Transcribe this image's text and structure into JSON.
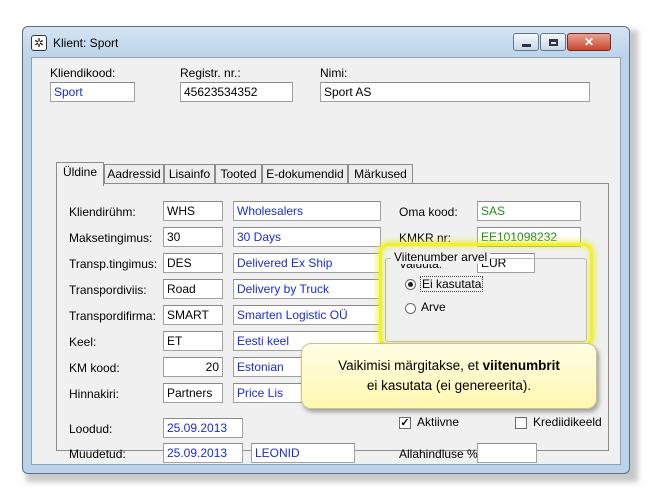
{
  "window": {
    "title": "Klient: Sport"
  },
  "header": {
    "client_code_label": "Kliendikood:",
    "client_code": "Sport",
    "reg_no_label": "Registr. nr.:",
    "reg_no": "45623534352",
    "name_label": "Nimi:",
    "name": "Sport AS"
  },
  "tabs": [
    {
      "label": "Üldine"
    },
    {
      "label": "Aadressid"
    },
    {
      "label": "Lisainfo"
    },
    {
      "label": "Tooted"
    },
    {
      "label": "E-dokumendid"
    },
    {
      "label": "Märkused"
    }
  ],
  "general": {
    "client_group": {
      "label": "Kliendirühm:",
      "code": "WHS",
      "desc": "Wholesalers"
    },
    "payment_terms": {
      "label": "Maksetingimus:",
      "code": "30",
      "desc": "30 Days"
    },
    "transport_terms": {
      "label": "Transp.tingimus:",
      "code": "DES",
      "desc": "Delivered Ex Ship"
    },
    "transport_mode": {
      "label": "Transpordiviis:",
      "code": "Road",
      "desc": "Delivery by Truck"
    },
    "transport_company": {
      "label": "Transpordifirma:",
      "code": "SMART",
      "desc": "Smarten Logistic OÜ"
    },
    "language": {
      "label": "Keel:",
      "code": "ET",
      "desc": "Eesti keel"
    },
    "vat_code": {
      "label": "KM kood:",
      "code": "20",
      "desc": "Estonian"
    },
    "price_list": {
      "label": "Hinnakiri:",
      "code": "Partners",
      "desc": "Price Lis"
    },
    "created": {
      "label": "Loodud:",
      "date": "25.09.2013"
    },
    "modified": {
      "label": "Muudetud:",
      "date": "25.09.2013",
      "user": "LEONID"
    },
    "own_code": {
      "label": "Oma kood:",
      "value": "SAS"
    },
    "vat_reg": {
      "label": "KMKR nr:",
      "value": "EE101098232"
    },
    "currency": {
      "label": "Valuuta:",
      "value": "EUR"
    },
    "ref_group": {
      "title": "Viitenumber arvel",
      "option_not_used": "Ei kasutata",
      "option_invoice": "Arve"
    },
    "active": {
      "label": "Aktiivne",
      "checked": true
    },
    "credit_block": {
      "label": "Krediidikeeld",
      "checked": false
    },
    "discount": {
      "label": "Allahindluse %:",
      "value": ""
    }
  },
  "callout": {
    "text_before": "Vaikimisi märgitakse, et ",
    "text_bold": "viitenumbrit",
    "text_after": "ei kasutata (ei genereerita)."
  },
  "colors": {
    "highlight": "#f1f21e",
    "callout_bg": "#fff8b0",
    "link_blue": "#1a2bd6",
    "code_green": "#1e8a1e"
  }
}
